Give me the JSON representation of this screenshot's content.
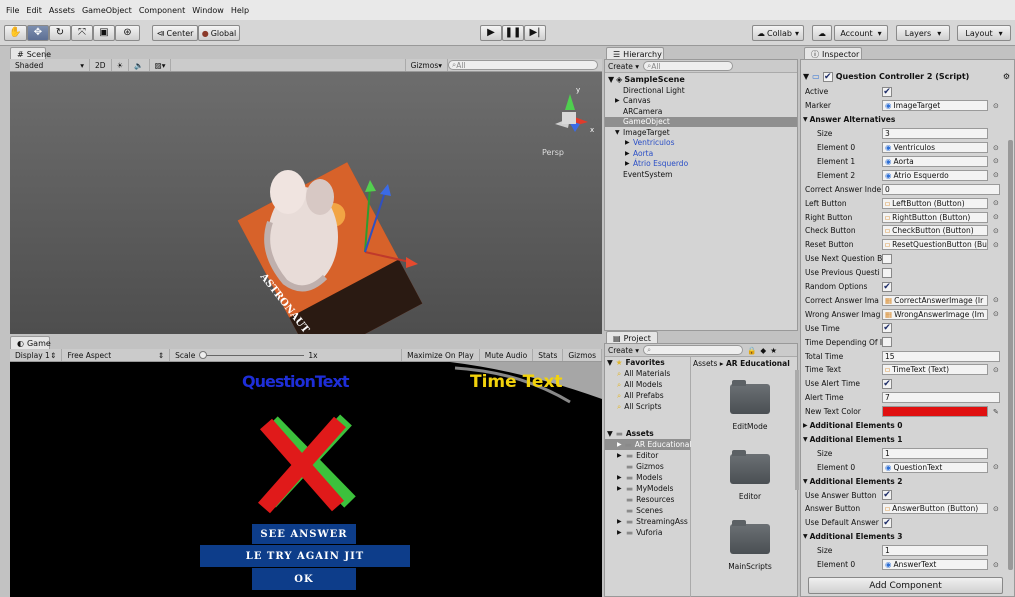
{
  "menu": [
    "File",
    "Edit",
    "Assets",
    "GameObject",
    "Component",
    "Window",
    "Help"
  ],
  "toolbar": {
    "pivot_label": "Center",
    "space_label": "Global",
    "collab_label": "Collab",
    "account_label": "Account",
    "layers_label": "Layers",
    "layout_label": "Layout"
  },
  "scene": {
    "tab": "Scene",
    "shading": "Shaded",
    "mode_2d": "2D",
    "gizmos": "Gizmos",
    "search_placeholder": "All",
    "persp": "Persp",
    "card_text": "ASTRONAUT"
  },
  "game": {
    "tab": "Game",
    "display": "Display 1",
    "aspect": "Free Aspect",
    "scale": "Scale",
    "scale_value": "1x",
    "maximize": "Maximize On Play",
    "mute": "Mute Audio",
    "stats": "Stats",
    "gizmos": "Gizmos",
    "question_text": "QuestionText",
    "time_text": "Time Text",
    "btn_see": "SEE ANSWER",
    "btn_try": "LE  TRY AGAIN  JIT",
    "btn_ok": "OK"
  },
  "hierarchy": {
    "tab": "Hierarchy",
    "create": "Create",
    "search_placeholder": "All",
    "scene_name": "SampleScene",
    "items": [
      {
        "label": "Directional Light",
        "indent": 1,
        "arrow": "",
        "blue": false,
        "selected": false
      },
      {
        "label": "Canvas",
        "indent": 1,
        "arrow": "▶",
        "blue": false,
        "selected": false
      },
      {
        "label": "ARCamera",
        "indent": 1,
        "arrow": "",
        "blue": false,
        "selected": false
      },
      {
        "label": "GameObject",
        "indent": 1,
        "arrow": "",
        "blue": false,
        "selected": true
      },
      {
        "label": "ImageTarget",
        "indent": 1,
        "arrow": "▼",
        "blue": false,
        "selected": false
      },
      {
        "label": "Ventriculos",
        "indent": 2,
        "arrow": "▶",
        "blue": true,
        "selected": false
      },
      {
        "label": "Aorta",
        "indent": 2,
        "arrow": "▶",
        "blue": true,
        "selected": false
      },
      {
        "label": "Átrio Esquerdo",
        "indent": 2,
        "arrow": "▶",
        "blue": true,
        "selected": false
      },
      {
        "label": "EventSystem",
        "indent": 1,
        "arrow": "",
        "blue": false,
        "selected": false
      }
    ]
  },
  "project": {
    "tab": "Project",
    "create": "Create",
    "favorites": "Favorites",
    "fav_items": [
      "All Materials",
      "All Models",
      "All Prefabs",
      "All Scripts"
    ],
    "assets": "Assets",
    "asset_items": [
      {
        "label": "AR Educational",
        "arrow": "▶",
        "selected": true
      },
      {
        "label": "Editor",
        "arrow": "▶",
        "selected": false
      },
      {
        "label": "Gizmos",
        "arrow": "",
        "selected": false
      },
      {
        "label": "Models",
        "arrow": "▶",
        "selected": false
      },
      {
        "label": "MyModels",
        "arrow": "▶",
        "selected": false
      },
      {
        "label": "Resources",
        "arrow": "",
        "selected": false
      },
      {
        "label": "Scenes",
        "arrow": "",
        "selected": false
      },
      {
        "label": "StreamingAss",
        "arrow": "▶",
        "selected": false
      },
      {
        "label": "Vuforia",
        "arrow": "▶",
        "selected": false
      }
    ],
    "breadcrumb_root": "Assets",
    "breadcrumb_current": "AR Educational",
    "folders": [
      "EditMode",
      "Editor",
      "MainScripts"
    ]
  },
  "inspector": {
    "tab": "Inspector",
    "component": "Question Controller 2 (Script)",
    "add_component": "Add Component",
    "new_text_color": "#e01010",
    "rows": [
      {
        "type": "check",
        "label": "Active",
        "value": "✔"
      },
      {
        "type": "ref",
        "label": "Marker",
        "value": "ImageTarget",
        "icon": "go"
      },
      {
        "type": "header",
        "label": "Answer Alternatives",
        "arrow": "▼"
      },
      {
        "type": "text",
        "label": "Size",
        "value": "3",
        "sub": true
      },
      {
        "type": "ref",
        "label": "Element 0",
        "value": "Ventriculos",
        "icon": "go",
        "sub": true
      },
      {
        "type": "ref",
        "label": "Element 1",
        "value": "Aorta",
        "icon": "go",
        "sub": true
      },
      {
        "type": "ref",
        "label": "Element 2",
        "value": "Átrio Esquerdo",
        "icon": "go",
        "sub": true
      },
      {
        "type": "text",
        "label": "Correct Answer Inde",
        "value": "0",
        "wide": true
      },
      {
        "type": "ref",
        "label": "Left Button",
        "value": "LeftButton (Button)",
        "icon": "ref"
      },
      {
        "type": "ref",
        "label": "Right Button",
        "value": "RightButton (Button)",
        "icon": "ref"
      },
      {
        "type": "ref",
        "label": "Check Button",
        "value": "CheckButton (Button)",
        "icon": "ref"
      },
      {
        "type": "ref",
        "label": "Reset Button",
        "value": "ResetQuestionButton (Bu",
        "icon": "ref"
      },
      {
        "type": "check",
        "label": "Use Next Question B",
        "value": ""
      },
      {
        "type": "check",
        "label": "Use Previous Questi",
        "value": ""
      },
      {
        "type": "check",
        "label": "Random Options",
        "value": "✔"
      },
      {
        "type": "ref",
        "label": "Correct Answer Ima",
        "value": "CorrectAnswerImage (Ir",
        "icon": "img"
      },
      {
        "type": "ref",
        "label": "Wrong Answer Imag",
        "value": "WrongAnswerImage (Im",
        "icon": "img"
      },
      {
        "type": "check",
        "label": "Use Time",
        "value": "✔"
      },
      {
        "type": "check",
        "label": "Time Depending Of I",
        "value": ""
      },
      {
        "type": "text",
        "label": "Total Time",
        "value": "15",
        "wide": true
      },
      {
        "type": "ref",
        "label": "Time Text",
        "value": "TimeText (Text)",
        "icon": "ref"
      },
      {
        "type": "check",
        "label": "Use Alert Time",
        "value": "✔"
      },
      {
        "type": "text",
        "label": "Alert Time",
        "value": "7",
        "wide": true
      },
      {
        "type": "color",
        "label": "New Text Color",
        "value": ""
      },
      {
        "type": "header",
        "label": "Additional Elements 0",
        "arrow": "▶"
      },
      {
        "type": "header",
        "label": "Additional Elements 1",
        "arrow": "▼"
      },
      {
        "type": "text",
        "label": "Size",
        "value": "1",
        "sub": true
      },
      {
        "type": "ref",
        "label": "Element 0",
        "value": "QuestionText",
        "icon": "go",
        "sub": true
      },
      {
        "type": "header",
        "label": "Additional Elements 2",
        "arrow": "▼"
      },
      {
        "type": "check",
        "label": "Use Answer Button",
        "value": "✔"
      },
      {
        "type": "ref",
        "label": "Answer Button",
        "value": "AnswerButton (Button)",
        "icon": "ref"
      },
      {
        "type": "check",
        "label": "Use Default Answer",
        "value": "✔"
      },
      {
        "type": "header",
        "label": "Additional Elements 3",
        "arrow": "▼"
      },
      {
        "type": "text",
        "label": "Size",
        "value": "1",
        "sub": true
      },
      {
        "type": "ref",
        "label": "Element 0",
        "value": "AnswerText",
        "icon": "go",
        "sub": true
      }
    ]
  }
}
